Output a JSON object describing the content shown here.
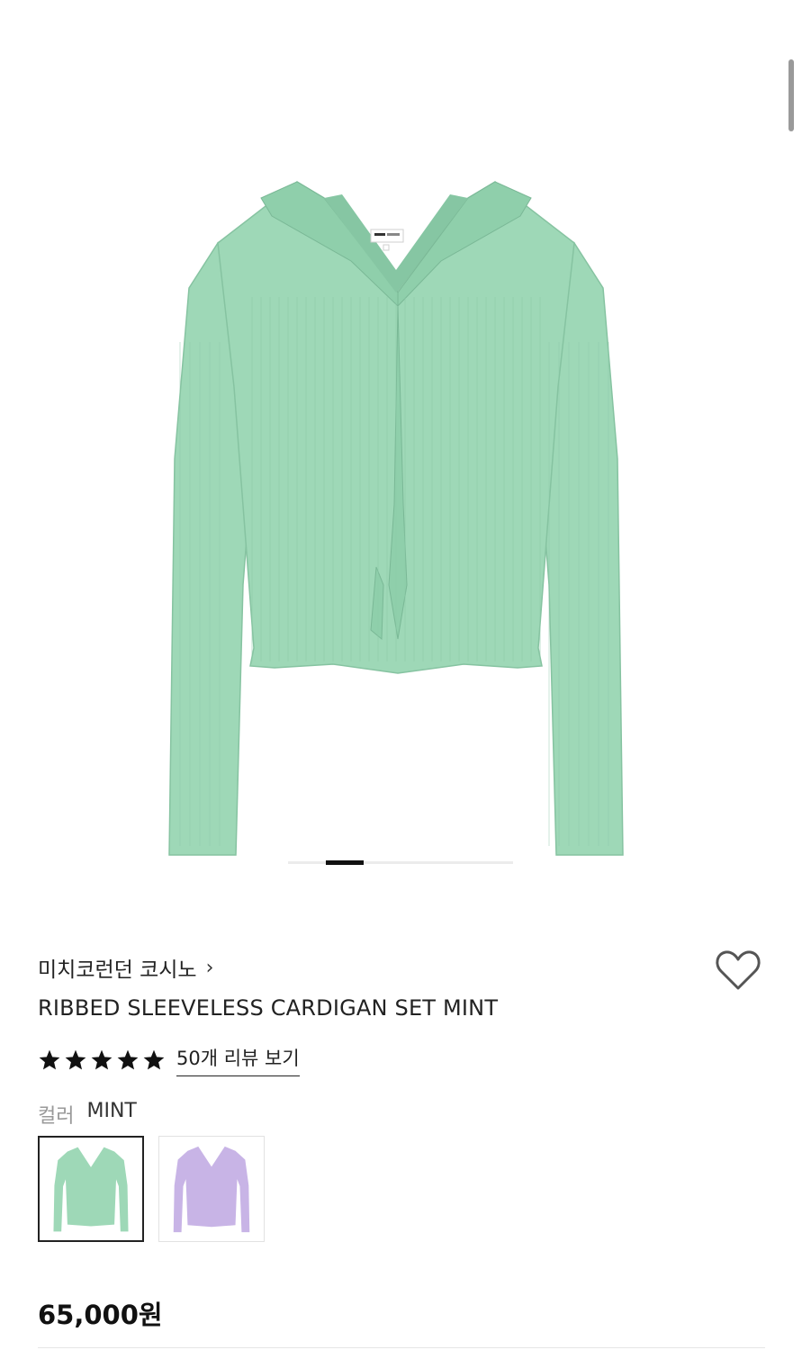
{
  "product": {
    "brand": "미치코런던 코시노",
    "name": "RIBBED SLEEVELESS CARDIGAN SET MINT",
    "rating_stars": 5,
    "reviews_link": "50개 리뷰 보기",
    "color_label": "컬러",
    "color_value": "MINT",
    "price": "65,000원"
  },
  "gallery": {
    "active_slide": 2,
    "garment_color": "#9ED8B7"
  },
  "swatches": [
    {
      "name": "mint",
      "color": "#9ED8B7",
      "selected": true
    },
    {
      "name": "lavender",
      "color": "#C8B4E6",
      "selected": false
    }
  ],
  "icons": {
    "wishlist": "heart-outline-icon",
    "brand_link": "chevron-right-icon",
    "star": "star-filled-icon"
  }
}
